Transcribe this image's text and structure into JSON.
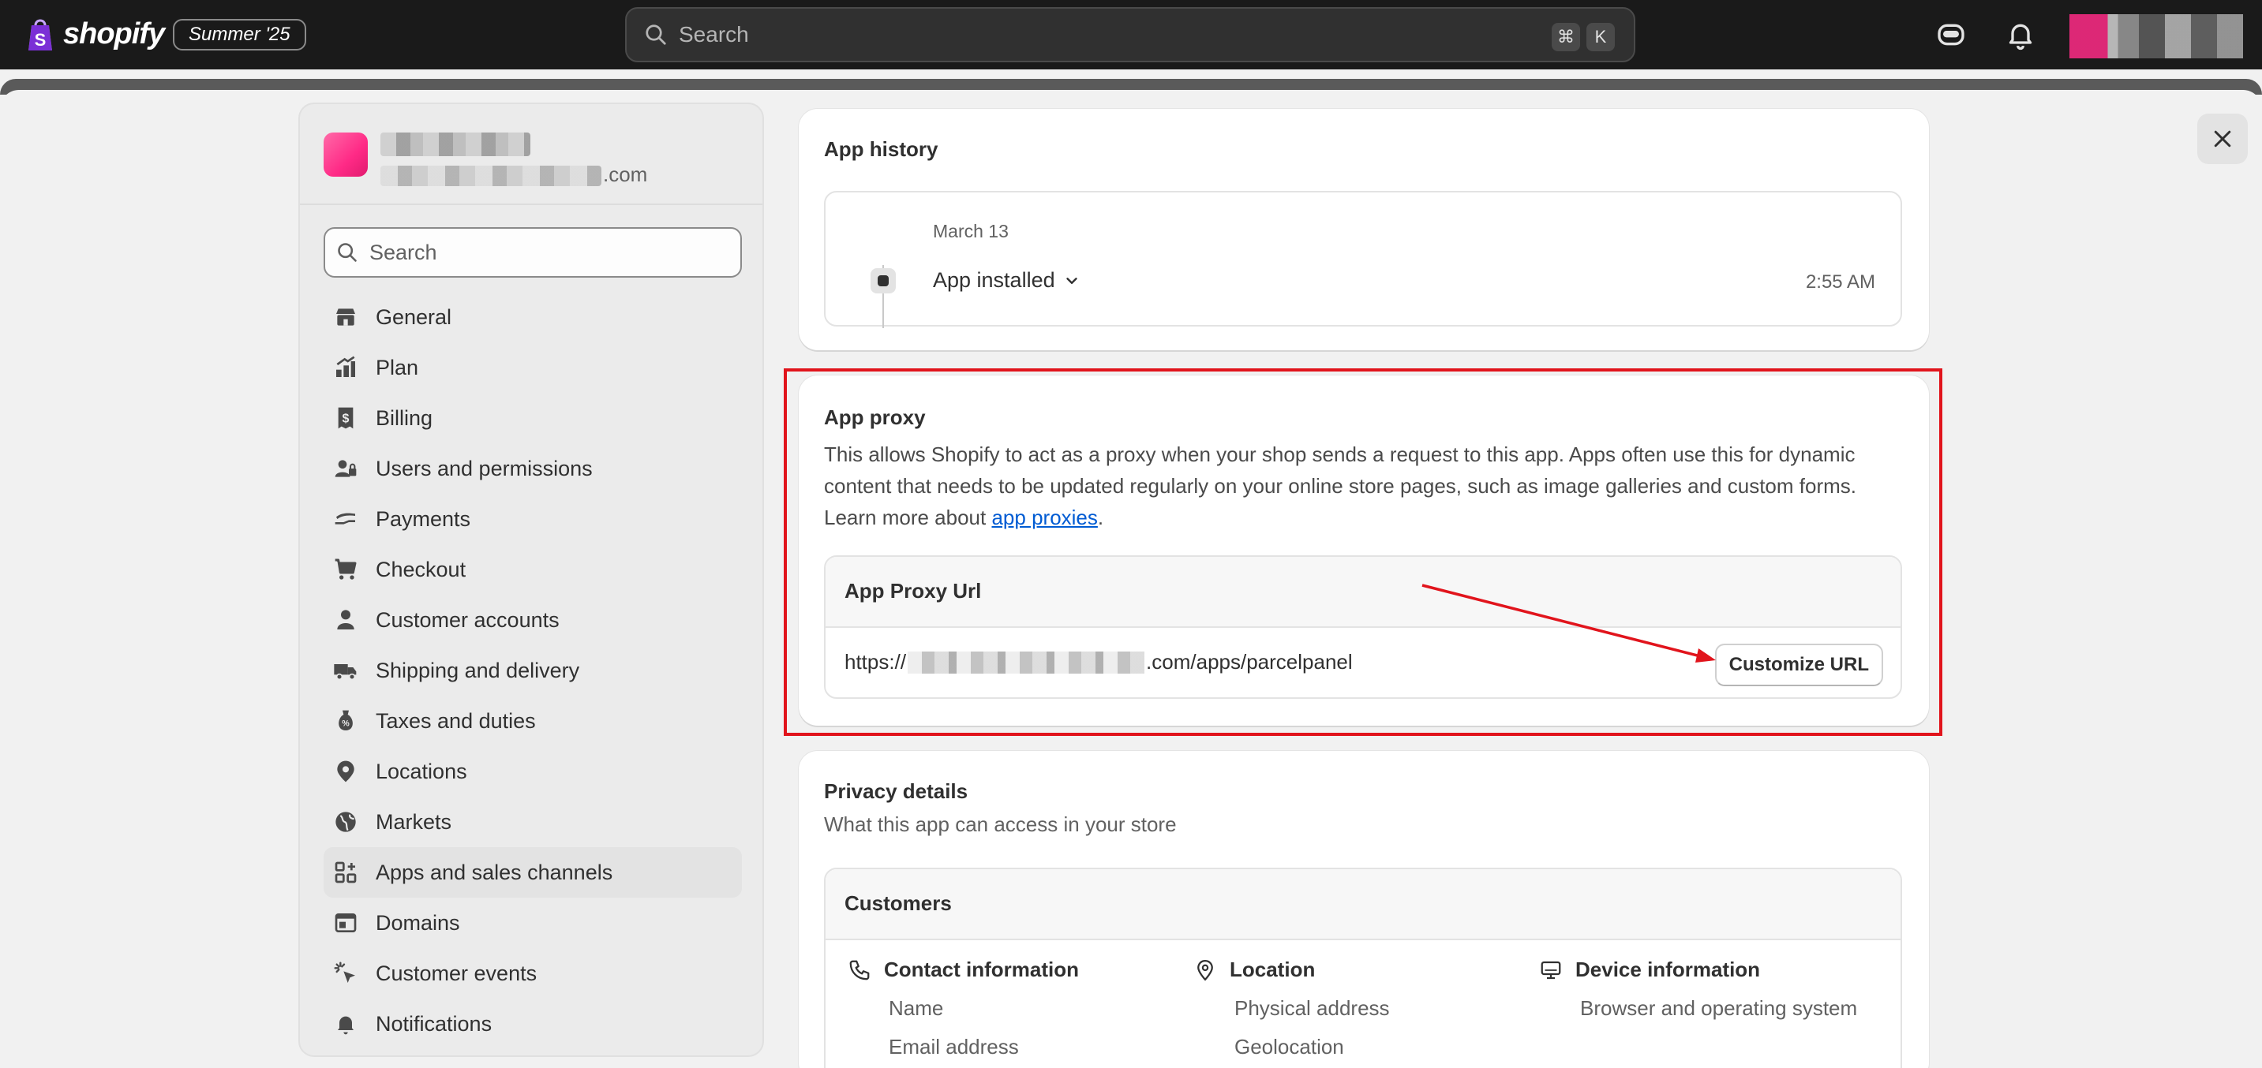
{
  "topbar": {
    "brand": "shopify",
    "badge": "Summer '25",
    "search_placeholder": "Search",
    "shortcut_cmd": "⌘",
    "shortcut_key": "K"
  },
  "store": {
    "email_suffix": ".com"
  },
  "sidebar": {
    "search_placeholder": "Search",
    "items": [
      {
        "label": "General",
        "icon": "store-icon"
      },
      {
        "label": "Plan",
        "icon": "plan-icon"
      },
      {
        "label": "Billing",
        "icon": "billing-icon"
      },
      {
        "label": "Users and permissions",
        "icon": "users-icon"
      },
      {
        "label": "Payments",
        "icon": "payments-icon"
      },
      {
        "label": "Checkout",
        "icon": "cart-icon"
      },
      {
        "label": "Customer accounts",
        "icon": "person-icon"
      },
      {
        "label": "Shipping and delivery",
        "icon": "truck-icon"
      },
      {
        "label": "Taxes and duties",
        "icon": "tax-icon"
      },
      {
        "label": "Locations",
        "icon": "location-icon"
      },
      {
        "label": "Markets",
        "icon": "globe-icon"
      },
      {
        "label": "Apps and sales channels",
        "icon": "apps-icon",
        "active": true
      },
      {
        "label": "Domains",
        "icon": "domains-icon"
      },
      {
        "label": "Customer events",
        "icon": "cursor-icon"
      },
      {
        "label": "Notifications",
        "icon": "bell-icon"
      }
    ]
  },
  "app_history": {
    "title": "App history",
    "date": "March 13",
    "event": "App installed",
    "time": "2:55 AM"
  },
  "app_proxy": {
    "title": "App proxy",
    "description": "This allows Shopify to act as a proxy when your shop sends a request to this app. Apps often use this for dynamic content that needs to be updated regularly on your online store pages, such as image galleries and custom forms. Learn more about ",
    "link_text": "app proxies",
    "description_end": ".",
    "url_label": "App Proxy Url",
    "url_prefix": "https://",
    "url_suffix": ".com/apps/parcelpanel",
    "customize_label": "Customize URL",
    "highlight_color": "#e1141c"
  },
  "privacy": {
    "title": "Privacy details",
    "subtitle": "What this app can access in your store",
    "section": "Customers",
    "columns": [
      {
        "title": "Contact information",
        "icon": "phone-icon",
        "items": [
          "Name",
          "Email address"
        ]
      },
      {
        "title": "Location",
        "icon": "pin-icon",
        "items": [
          "Physical address",
          "Geolocation"
        ]
      },
      {
        "title": "Device information",
        "icon": "monitor-icon",
        "items": [
          "Browser and operating system"
        ]
      }
    ]
  }
}
